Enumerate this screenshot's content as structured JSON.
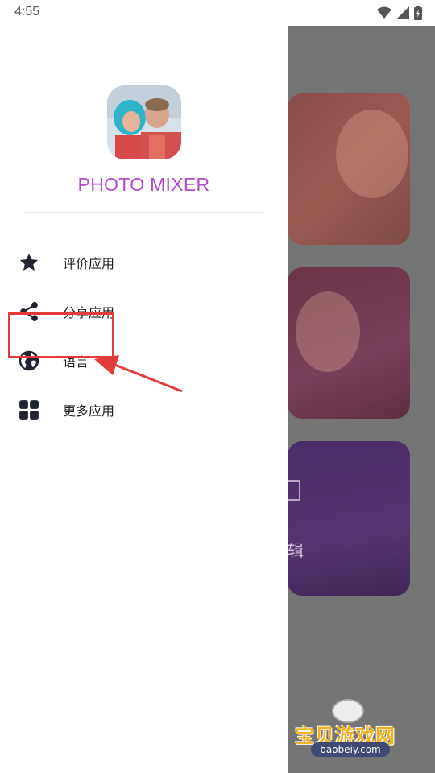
{
  "status_bar": {
    "time": "4:55",
    "icons": [
      "wifi-icon",
      "signal-icon",
      "battery-icon"
    ]
  },
  "drawer": {
    "app_title": "PHOTO MIXER",
    "logo_icon": "app-logo-photo-icon",
    "menu": [
      {
        "label": "评价应用",
        "icon": "star-icon"
      },
      {
        "label": "分享应用",
        "icon": "share-icon"
      },
      {
        "label": "语言",
        "icon": "globe-icon"
      },
      {
        "label": "更多应用",
        "icon": "grid-icon"
      }
    ]
  },
  "background": {
    "card3_label": "辑"
  },
  "annotation": {
    "highlight_target": "语言",
    "color": "#e33a3a"
  },
  "watermark": {
    "text": "宝贝游戏网",
    "url": "baobeiy.com"
  },
  "colors": {
    "accent": "#b44ad1",
    "icon": "#1f2430",
    "scrim": "#757575"
  }
}
